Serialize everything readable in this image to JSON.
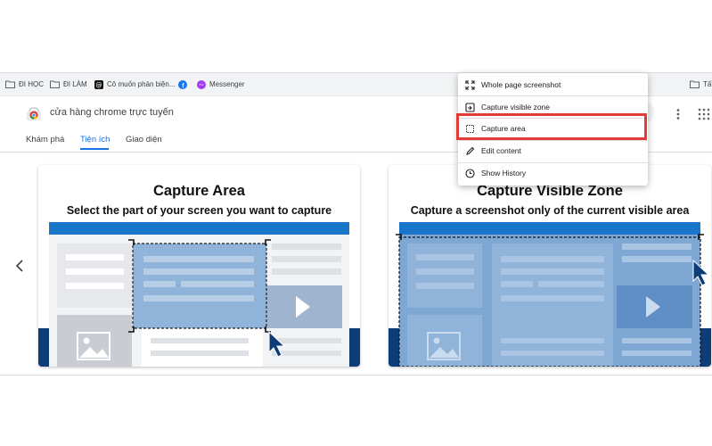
{
  "bookmarks": {
    "items": [
      {
        "label": "ĐI HỌC",
        "icon": "folder-icon"
      },
      {
        "label": "ĐI LÀM",
        "icon": "folder-icon"
      },
      {
        "label": "Cô muốn phản biện...",
        "icon": "threads-icon"
      },
      {
        "label": "",
        "icon": "facebook-icon"
      },
      {
        "label": "Messenger",
        "icon": "messenger-icon"
      }
    ],
    "right_folder_label": "Tất"
  },
  "store": {
    "title": "cửa hàng chrome trực tuyến",
    "tabs": [
      {
        "label": "Khám phá"
      },
      {
        "label": "Tiện ích",
        "active": true
      },
      {
        "label": "Giao diện"
      }
    ]
  },
  "menu": {
    "items": [
      {
        "label": "Whole page screenshot",
        "icon": "expand-icon"
      },
      {
        "label": "Capture visible zone",
        "icon": "visible-zone-icon"
      },
      {
        "label": "Capture area",
        "icon": "crop-area-icon",
        "highlighted": true
      },
      {
        "label": "Edit content",
        "icon": "pencil-icon"
      },
      {
        "label": "Show History",
        "icon": "history-icon"
      }
    ],
    "highlight_color": "#e23a37"
  },
  "cards": [
    {
      "title": "Capture Area",
      "subtitle": "Select the part of your screen you want to capture"
    },
    {
      "title": "Capture Visible Zone",
      "subtitle": "Capture a screenshot only of the current visible area"
    }
  ],
  "colors": {
    "accent": "#1a73e8",
    "illustration_blue": "#1976c9",
    "illustration_navy": "#0d3d78"
  }
}
